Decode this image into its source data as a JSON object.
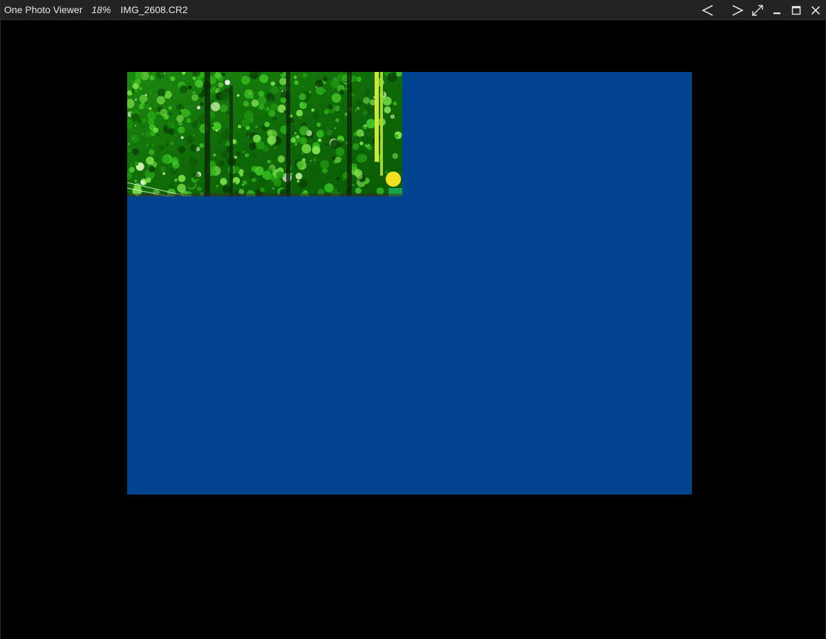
{
  "titlebar": {
    "app_title": "One Photo Viewer",
    "zoom": "18%",
    "file_name": "IMG_2608.CR2",
    "buttons": {
      "previous_icon": "chevron-left-icon",
      "next_icon": "chevron-right-icon",
      "fullscreen_icon": "expand-diagonal-icon",
      "minimize_icon": "minimize-icon",
      "maximize_icon": "maximize-icon",
      "close_icon": "close-icon"
    }
  },
  "viewer": {
    "background_color": "#000000",
    "placeholder_color": "#00448f",
    "photo_subject": "green foliage / trees"
  }
}
